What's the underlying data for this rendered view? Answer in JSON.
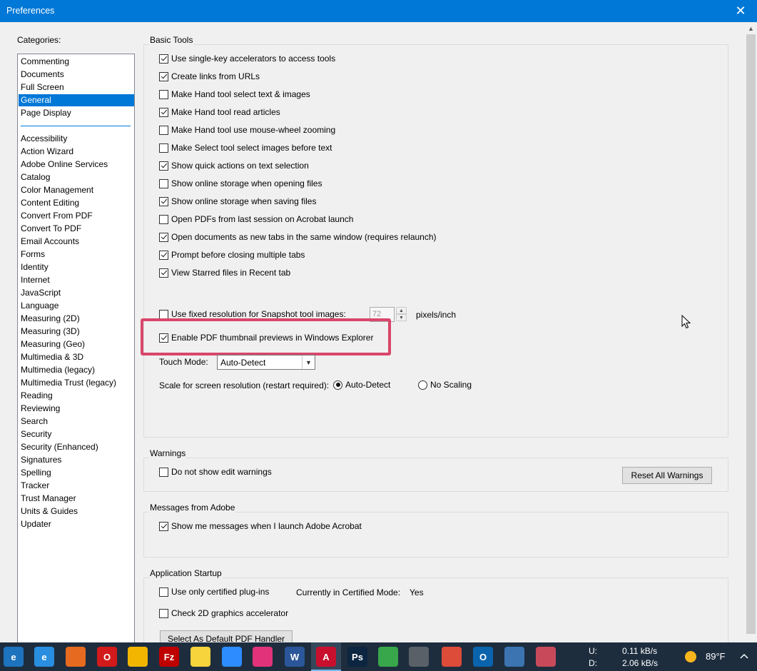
{
  "window": {
    "title": "Preferences",
    "close_glyph": "✕"
  },
  "categories": {
    "label": "Categories:",
    "group1": [
      "Commenting",
      "Documents",
      "Full Screen",
      "General",
      "Page Display"
    ],
    "selected": "General",
    "group2": [
      "Accessibility",
      "Action Wizard",
      "Adobe Online Services",
      "Catalog",
      "Color Management",
      "Content Editing",
      "Convert From PDF",
      "Convert To PDF",
      "Email Accounts",
      "Forms",
      "Identity",
      "Internet",
      "JavaScript",
      "Language",
      "Measuring (2D)",
      "Measuring (3D)",
      "Measuring (Geo)",
      "Multimedia & 3D",
      "Multimedia (legacy)",
      "Multimedia Trust (legacy)",
      "Reading",
      "Reviewing",
      "Search",
      "Security",
      "Security (Enhanced)",
      "Signatures",
      "Spelling",
      "Tracker",
      "Trust Manager",
      "Units & Guides",
      "Updater"
    ]
  },
  "basic_tools": {
    "title": "Basic Tools",
    "options": [
      {
        "label": "Use single-key accelerators to access tools",
        "checked": true
      },
      {
        "label": "Create links from URLs",
        "checked": true
      },
      {
        "label": "Make Hand tool select text & images",
        "checked": false
      },
      {
        "label": "Make Hand tool read articles",
        "checked": true
      },
      {
        "label": "Make Hand tool use mouse-wheel zooming",
        "checked": false
      },
      {
        "label": "Make Select tool select images before text",
        "checked": false
      },
      {
        "label": "Show quick actions on text selection",
        "checked": true
      },
      {
        "label": "Show online storage when opening files",
        "checked": false
      },
      {
        "label": "Show online storage when saving files",
        "checked": true
      },
      {
        "label": "Open PDFs from last session on Acrobat launch",
        "checked": false
      },
      {
        "label": "Open documents as new tabs in the same window (requires relaunch)",
        "checked": true
      },
      {
        "label": "Prompt before closing multiple tabs",
        "checked": true
      },
      {
        "label": "View Starred files in Recent tab",
        "checked": true
      }
    ],
    "fixed_resolution": {
      "label": "Use fixed resolution for Snapshot tool images:",
      "checked": false,
      "value": "72",
      "unit": "pixels/inch"
    },
    "thumbnail": {
      "label": "Enable PDF thumbnail previews in Windows Explorer",
      "checked": true
    },
    "touch_mode": {
      "label": "Touch Mode:",
      "value": "Auto-Detect"
    },
    "scale": {
      "label": "Scale for screen resolution (restart required):",
      "options": [
        "Auto-Detect",
        "No Scaling"
      ],
      "selected": "Auto-Detect"
    }
  },
  "warnings": {
    "title": "Warnings",
    "checkbox": {
      "label": "Do not show edit warnings",
      "checked": false
    },
    "reset_label": "Reset All Warnings"
  },
  "messages": {
    "title": "Messages from Adobe",
    "checkbox": {
      "label": "Show me messages when I launch Adobe Acrobat",
      "checked": true
    }
  },
  "startup": {
    "title": "Application Startup",
    "certified": {
      "label": "Use only certified plug-ins",
      "checked": false
    },
    "mode_label": "Currently in Certified Mode:",
    "mode_value": "Yes",
    "accel": {
      "label": "Check 2D graphics accelerator",
      "checked": false
    },
    "default_handler_label": "Select As Default PDF Handler"
  },
  "taskbar": {
    "icon_names": [
      "internet-explorer-icon",
      "edge-icon",
      "firefox-icon",
      "opera-icon",
      "file-explorer-icon",
      "filezilla-icon",
      "sticky-notes-icon",
      "zoom-icon",
      "creative-cloud-icon",
      "word-icon",
      "acrobat-icon",
      "photoshop-icon",
      "edge-beta-icon",
      "speaker-icon",
      "chrome-icon",
      "outlook-icon",
      "audio-tool-icon",
      "recorder-icon"
    ],
    "glyphs": [
      "e",
      "e",
      "",
      "O",
      "",
      "Fz",
      "",
      "",
      "",
      "W",
      "A",
      "Ps",
      "",
      "",
      "",
      "O",
      "",
      ""
    ],
    "colors": [
      "#1e73be",
      "#2a8ee0",
      "#e66a1f",
      "#d21a1a",
      "#f2b600",
      "#bf0000",
      "#f7d33c",
      "#2d8cff",
      "#e2337a",
      "#2b579a",
      "#c8102e",
      "#0c2540",
      "#38a64a",
      "#5a6068",
      "#dd4b39",
      "#0a64ad",
      "#3c74b2",
      "#c84a5a"
    ],
    "active_index": 10,
    "net_up_label": "U:",
    "net_up": "0.11 kB/s",
    "net_down_label": "D:",
    "net_down": "2.06 kB/s",
    "temperature": "89°F"
  }
}
